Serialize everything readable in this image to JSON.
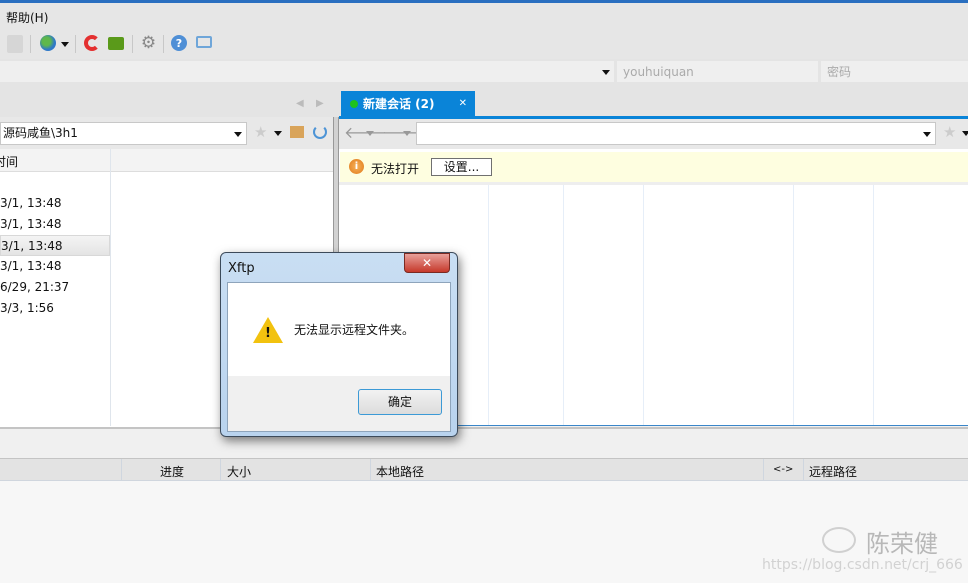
{
  "menu": {
    "help": "帮助(H)"
  },
  "toolbar": {
    "icons": [
      "copy-icon",
      "globe-icon",
      "xshell-icon",
      "xftp-icon",
      "settings-icon",
      "help-icon",
      "chat-icon"
    ]
  },
  "address": {
    "username": "youhuiquan",
    "password_placeholder": "密码"
  },
  "tabs": [
    {
      "label": "新建会话 (2)",
      "status_color": "#1ec21e"
    }
  ],
  "accent": "#0a84d8",
  "local": {
    "path": "源码咸鱼\\3h1",
    "column": "时间",
    "rows": [
      "3/1, 13:48",
      "3/1, 13:48",
      "3/1, 13:48",
      "3/1, 13:48",
      "6/29, 21:37",
      "3/3, 1:56"
    ],
    "selected_index": 2
  },
  "remote": {
    "path": "",
    "info": "无法打开",
    "settings_button": "设置..."
  },
  "dialog": {
    "title": "Xftp",
    "message": "无法显示远程文件夹。",
    "ok": "确定",
    "close": "✕"
  },
  "transfers": {
    "columns": [
      "进度",
      "大小",
      "本地路径",
      "<->",
      "远程路径"
    ]
  },
  "watermark": {
    "name": "陈荣健",
    "url": "https://blog.csdn.net/crj_666"
  }
}
